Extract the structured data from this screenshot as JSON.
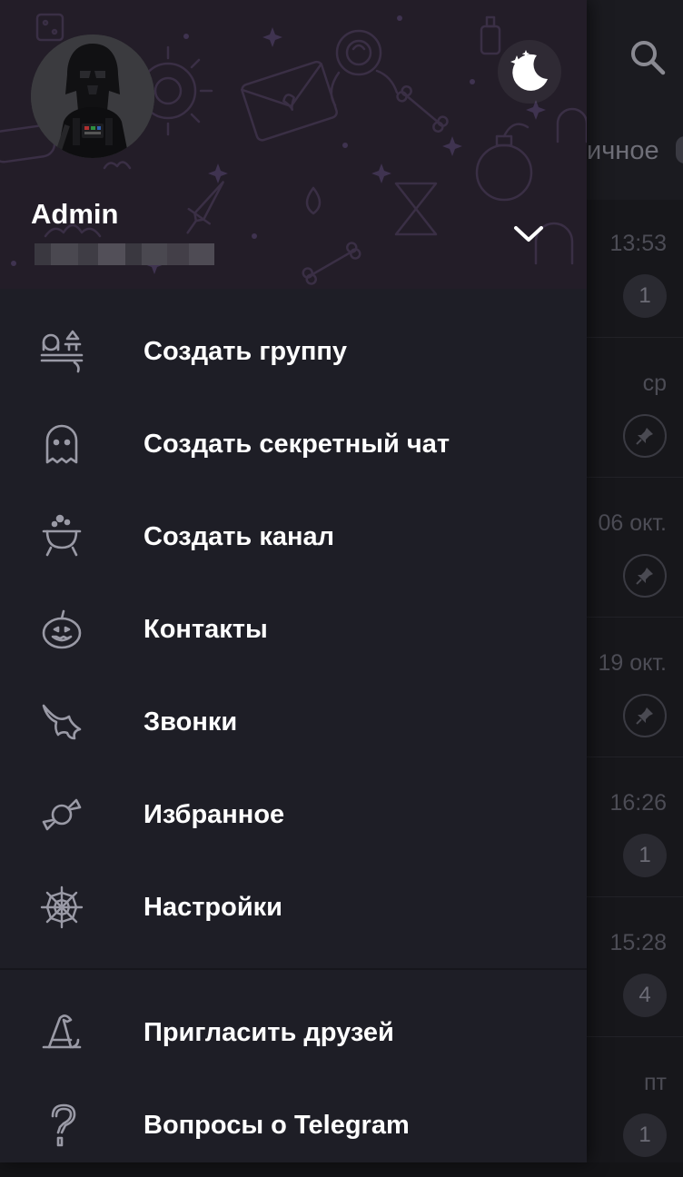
{
  "background": {
    "tab_label": "ичное",
    "rows": [
      {
        "time": "13:53",
        "badge": "1",
        "pinned": false
      },
      {
        "time": "ср",
        "badge": "",
        "pinned": true
      },
      {
        "time": "06 окт.",
        "badge": "",
        "pinned": true
      },
      {
        "time": "19 окт.",
        "badge": "",
        "pinned": true
      },
      {
        "time": "16:26",
        "badge": "1",
        "pinned": false
      },
      {
        "time": "15:28",
        "badge": "4",
        "pinned": false
      },
      {
        "time": "пт",
        "badge": "1",
        "pinned": false
      }
    ]
  },
  "drawer": {
    "user": {
      "name": "Admin"
    },
    "menu": [
      {
        "label": "Создать группу",
        "icon": "group-ghosts-icon"
      },
      {
        "label": "Создать секретный чат",
        "icon": "ghost-icon"
      },
      {
        "label": "Создать канал",
        "icon": "cauldron-icon"
      },
      {
        "label": "Контакты",
        "icon": "pumpkin-icon"
      },
      {
        "label": "Звонки",
        "icon": "bat-icon"
      },
      {
        "label": "Избранное",
        "icon": "candy-icon"
      },
      {
        "label": "Настройки",
        "icon": "spiderweb-icon"
      }
    ],
    "menu_secondary": [
      {
        "label": "Пригласить друзей",
        "icon": "witch-hat-icon"
      },
      {
        "label": "Вопросы о Telegram",
        "icon": "question-icon"
      }
    ]
  },
  "colors": {
    "drawer_bg": "#1e1e26",
    "header_bg": "#231d28",
    "icon_stroke": "#9a9aa6",
    "text": "#ffffff"
  }
}
